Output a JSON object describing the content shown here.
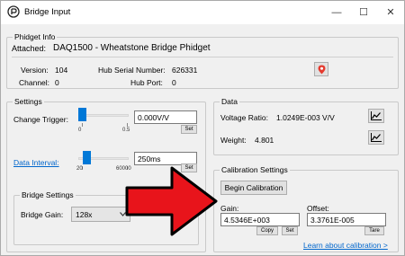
{
  "window": {
    "title": "Bridge Input",
    "minimize": "—",
    "maximize": "☐",
    "close": "✕"
  },
  "phidget_info": {
    "group_label": "Phidget Info",
    "attached_label": "Attached:",
    "attached_value": "DAQ1500 - Wheatstone Bridge Phidget",
    "version_label": "Version:",
    "version_value": "104",
    "hub_serial_label": "Hub Serial Number:",
    "hub_serial_value": "626331",
    "channel_label": "Channel:",
    "channel_value": "0",
    "hub_port_label": "Hub Port:",
    "hub_port_value": "0",
    "locate_icon": "map-pin-icon"
  },
  "settings": {
    "group_label": "Settings",
    "change_trigger_label": "Change Trigger:",
    "change_trigger_min": "0",
    "change_trigger_max": "0.5",
    "change_trigger_value": "0.000V/V",
    "set_label": "Set",
    "data_interval_label": "Data Interval:",
    "data_interval_min": "20",
    "data_interval_max": "60000",
    "data_interval_value": "250ms",
    "set_label_2": "Set"
  },
  "bridge_settings": {
    "group_label": "Bridge Settings",
    "gain_label": "Bridge Gain:",
    "gain_value": "128x",
    "dropdown_icon": "chevron-down-icon"
  },
  "data": {
    "group_label": "Data",
    "voltage_ratio_label": "Voltage Ratio:",
    "voltage_ratio_value": "1.0249E-003 V/V",
    "weight_label": "Weight:",
    "weight_value": "4.801",
    "graph_icon": "line-graph-icon"
  },
  "calibration": {
    "group_label": "Calibration Settings",
    "begin_button": "Begin Calibration",
    "gain_label": "Gain:",
    "gain_value": "4.5346E+003",
    "copy_label": "Copy",
    "set_label": "Set",
    "offset_label": "Offset:",
    "offset_value": "3.3761E-005",
    "tare_label": "Tare",
    "learn_link": "Learn about calibration >"
  },
  "overlay": {
    "arrow_color": "#e8141b",
    "arrow_outline": "#000000"
  }
}
